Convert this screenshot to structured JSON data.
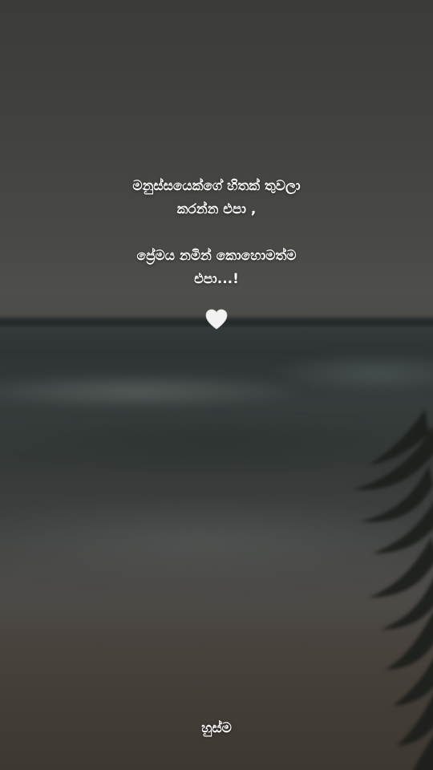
{
  "caption": {
    "line1": "මනුස්සයෙක්ගේ හිතක් තුවලා",
    "line2": "කරන්න එපා ,",
    "line3": "ප්‍රේමය නමින් කොහොමත්ම",
    "line4": "එපා...!"
  },
  "icons": {
    "heart": "white-heart-icon"
  },
  "signature": "හුස්ම",
  "colors": {
    "text": "#ffffff",
    "heart": "#f2f2f2"
  }
}
